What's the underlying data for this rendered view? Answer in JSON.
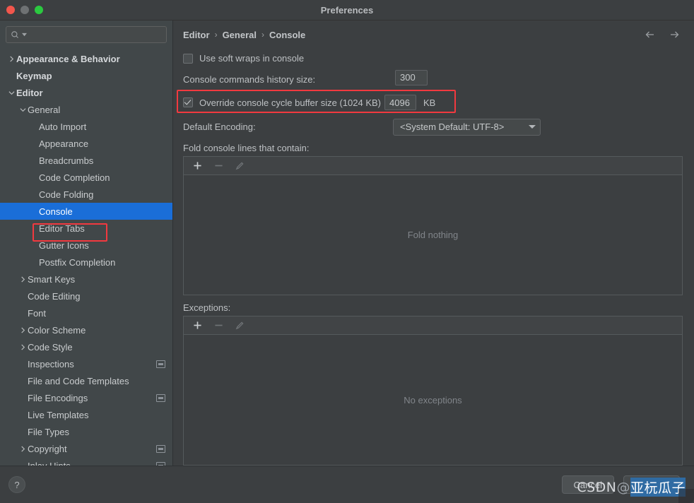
{
  "window": {
    "title": "Preferences",
    "traffic_lights": [
      "close",
      "minimize",
      "zoom"
    ]
  },
  "sidebar": {
    "search": {
      "value": "",
      "placeholder": ""
    },
    "items": [
      {
        "label": "Appearance & Behavior",
        "indent": 0,
        "twisty": "collapsed",
        "bold": true,
        "selected": false,
        "badge": false
      },
      {
        "label": "Keymap",
        "indent": 0,
        "twisty": "none",
        "bold": true,
        "selected": false,
        "badge": false
      },
      {
        "label": "Editor",
        "indent": 0,
        "twisty": "expanded",
        "bold": true,
        "selected": false,
        "badge": false
      },
      {
        "label": "General",
        "indent": 1,
        "twisty": "expanded",
        "bold": false,
        "selected": false,
        "badge": false
      },
      {
        "label": "Auto Import",
        "indent": 2,
        "twisty": "none",
        "bold": false,
        "selected": false,
        "badge": false
      },
      {
        "label": "Appearance",
        "indent": 2,
        "twisty": "none",
        "bold": false,
        "selected": false,
        "badge": false
      },
      {
        "label": "Breadcrumbs",
        "indent": 2,
        "twisty": "none",
        "bold": false,
        "selected": false,
        "badge": false
      },
      {
        "label": "Code Completion",
        "indent": 2,
        "twisty": "none",
        "bold": false,
        "selected": false,
        "badge": false
      },
      {
        "label": "Code Folding",
        "indent": 2,
        "twisty": "none",
        "bold": false,
        "selected": false,
        "badge": false
      },
      {
        "label": "Console",
        "indent": 2,
        "twisty": "none",
        "bold": false,
        "selected": true,
        "badge": false
      },
      {
        "label": "Editor Tabs",
        "indent": 2,
        "twisty": "none",
        "bold": false,
        "selected": false,
        "badge": false
      },
      {
        "label": "Gutter Icons",
        "indent": 2,
        "twisty": "none",
        "bold": false,
        "selected": false,
        "badge": false
      },
      {
        "label": "Postfix Completion",
        "indent": 2,
        "twisty": "none",
        "bold": false,
        "selected": false,
        "badge": false
      },
      {
        "label": "Smart Keys",
        "indent": 1,
        "twisty": "collapsed",
        "bold": false,
        "selected": false,
        "badge": false
      },
      {
        "label": "Code Editing",
        "indent": 1,
        "twisty": "none",
        "bold": false,
        "selected": false,
        "badge": false
      },
      {
        "label": "Font",
        "indent": 1,
        "twisty": "none",
        "bold": false,
        "selected": false,
        "badge": false
      },
      {
        "label": "Color Scheme",
        "indent": 1,
        "twisty": "collapsed",
        "bold": false,
        "selected": false,
        "badge": false
      },
      {
        "label": "Code Style",
        "indent": 1,
        "twisty": "collapsed",
        "bold": false,
        "selected": false,
        "badge": false
      },
      {
        "label": "Inspections",
        "indent": 1,
        "twisty": "none",
        "bold": false,
        "selected": false,
        "badge": true
      },
      {
        "label": "File and Code Templates",
        "indent": 1,
        "twisty": "none",
        "bold": false,
        "selected": false,
        "badge": false
      },
      {
        "label": "File Encodings",
        "indent": 1,
        "twisty": "none",
        "bold": false,
        "selected": false,
        "badge": true
      },
      {
        "label": "Live Templates",
        "indent": 1,
        "twisty": "none",
        "bold": false,
        "selected": false,
        "badge": false
      },
      {
        "label": "File Types",
        "indent": 1,
        "twisty": "none",
        "bold": false,
        "selected": false,
        "badge": false
      },
      {
        "label": "Copyright",
        "indent": 1,
        "twisty": "collapsed",
        "bold": false,
        "selected": false,
        "badge": true
      },
      {
        "label": "Inlay Hints",
        "indent": 1,
        "twisty": "none",
        "bold": false,
        "selected": false,
        "badge": true
      }
    ]
  },
  "main": {
    "breadcrumb": [
      "Editor",
      "General",
      "Console"
    ],
    "breadcrumb_separator": "›",
    "soft_wraps": {
      "label": "Use soft wraps in console",
      "checked": false
    },
    "history": {
      "label": "Console commands history size:",
      "value": "300"
    },
    "override_buffer": {
      "label": "Override console cycle buffer size (1024 KB)",
      "checked": true,
      "value": "4096",
      "unit": "KB"
    },
    "encoding": {
      "label": "Default Encoding:",
      "value": "<System Default: UTF-8>"
    },
    "fold": {
      "label": "Fold console lines that contain:",
      "empty_text": "Fold nothing",
      "toolbar": {
        "add": "+",
        "remove": "−",
        "edit": "edit"
      }
    },
    "exceptions": {
      "label": "Exceptions:",
      "empty_text": "No exceptions",
      "toolbar": {
        "add": "+",
        "remove": "−",
        "edit": "edit"
      }
    }
  },
  "footer": {
    "help": "?",
    "cancel_label": "Cancel",
    "ok_label": "OK"
  },
  "watermark": {
    "prefix": "CSDN ",
    "at": "@",
    "name": "亚杬瓜子"
  },
  "colors": {
    "selection_blue": "#1a6ed8",
    "highlight_red": "#f2393f",
    "window_bg": "#3c3f41",
    "sidebar_bg": "#414749"
  }
}
